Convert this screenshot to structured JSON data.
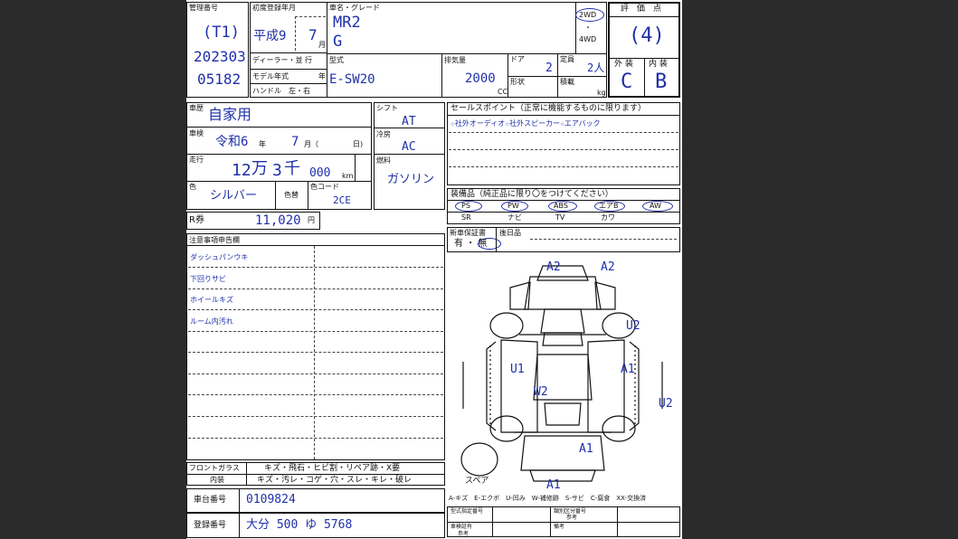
{
  "colors": {
    "ink": "#1f2fa8",
    "background": "#2b2b2b"
  },
  "header": {
    "mgmt_label": "管理番号",
    "mgmt_values": [
      "(T1)",
      "202303",
      "05182"
    ],
    "first_reg_label": "初度登録年月",
    "era": "平成9",
    "month": "7",
    "month_unit": "月",
    "dealer_label": "ディーラー・並 行",
    "model_year_label": "モデル年式",
    "year_unit": "年",
    "handle_label": "ハンドル　左・右",
    "car_name_label": "車名・グレード",
    "car_name": "MR2",
    "grade": "G",
    "drive_2wd": "2WD",
    "drive_dot": "・",
    "drive_4wd": "4WD",
    "model_label": "型式",
    "model_code": "E-SW20",
    "displacement_label": "排気量",
    "displacement": "2000",
    "cc": "CC",
    "door_label": "ドア",
    "doors": "2",
    "capacity_label": "定員",
    "capacity": "2人",
    "shape_label": "形状",
    "load_label": "積載",
    "kg": "kg",
    "score_label": "評　価　点",
    "score": "(4)",
    "exterior_label": "外 装",
    "interior_label": "内 装",
    "exterior": "C",
    "interior": "B"
  },
  "info": {
    "usage_label": "車歴",
    "usage": "自家用",
    "inspection_label": "車検",
    "inspection": "令和6",
    "insp_year_unit": "年",
    "insp_month": "7",
    "insp_month_unit": "月（",
    "insp_day_unit": "日)",
    "mileage_label": "走行",
    "mileage_a": "12",
    "mileage_man": "万",
    "mileage_b": "3",
    "mileage_sen": "千",
    "mileage_c": "000",
    "km": "km",
    "color_label": "色",
    "color": "シルバー",
    "color_change_label": "色替",
    "color_code_label": "色コード",
    "color_code": "2CE",
    "recycle_label": "R券",
    "recycle": "11,020",
    "yen": "円",
    "shift_label": "シフト",
    "shift": "AT",
    "ac_label": "冷房",
    "ac": "AC",
    "fuel_label": "燃料",
    "fuel": "ガソリン"
  },
  "sales": {
    "label": "セールスポイント（正常に機能するものに限ります）",
    "line1": "☆社外オーディオ☆社外スピーカー☆エアバック"
  },
  "equipment": {
    "label": "装備品（純正品に限り〇をつけてください）",
    "items": [
      "PS",
      "PW",
      "ABS",
      "エアB",
      "AW"
    ],
    "items2": [
      "SR",
      "ナビ",
      "TV",
      "カワ"
    ]
  },
  "warranty": {
    "label": "新車保証書",
    "value": "有 ・ 無",
    "after_label": "後日品"
  },
  "notes": {
    "label": "注意事項申告欄",
    "lines": [
      "ダッシュパンウキ",
      "下回りサビ",
      "ホイールキズ",
      "ルーム内汚れ"
    ]
  },
  "glass": {
    "front_label": "フロントガラス",
    "front_value": "キズ・飛石・ヒビ割・リペア跡・X要",
    "interior_label": "内装",
    "interior_value": "キズ・汚レ・コゲ・穴・スレ・キレ・破レ"
  },
  "vin": {
    "label": "車台番号",
    "value": "0109824"
  },
  "reg": {
    "label": "登録番号",
    "value": "大分 500 ゆ 5768"
  },
  "diagram": {
    "marks": [
      "A2",
      "A2",
      "U2",
      "U1",
      "A1",
      "W2",
      "U2",
      "A1",
      "A1"
    ],
    "spare": "スペア",
    "legend": "A-キズ　E-エクボ　U-凹み　W-補修跡　S-サビ　C-腐食　XX-交換済"
  },
  "footer": {
    "cells": [
      "型式指定番号",
      "類別区分番号",
      "車検証有",
      "備考",
      "参考",
      "参考"
    ]
  }
}
